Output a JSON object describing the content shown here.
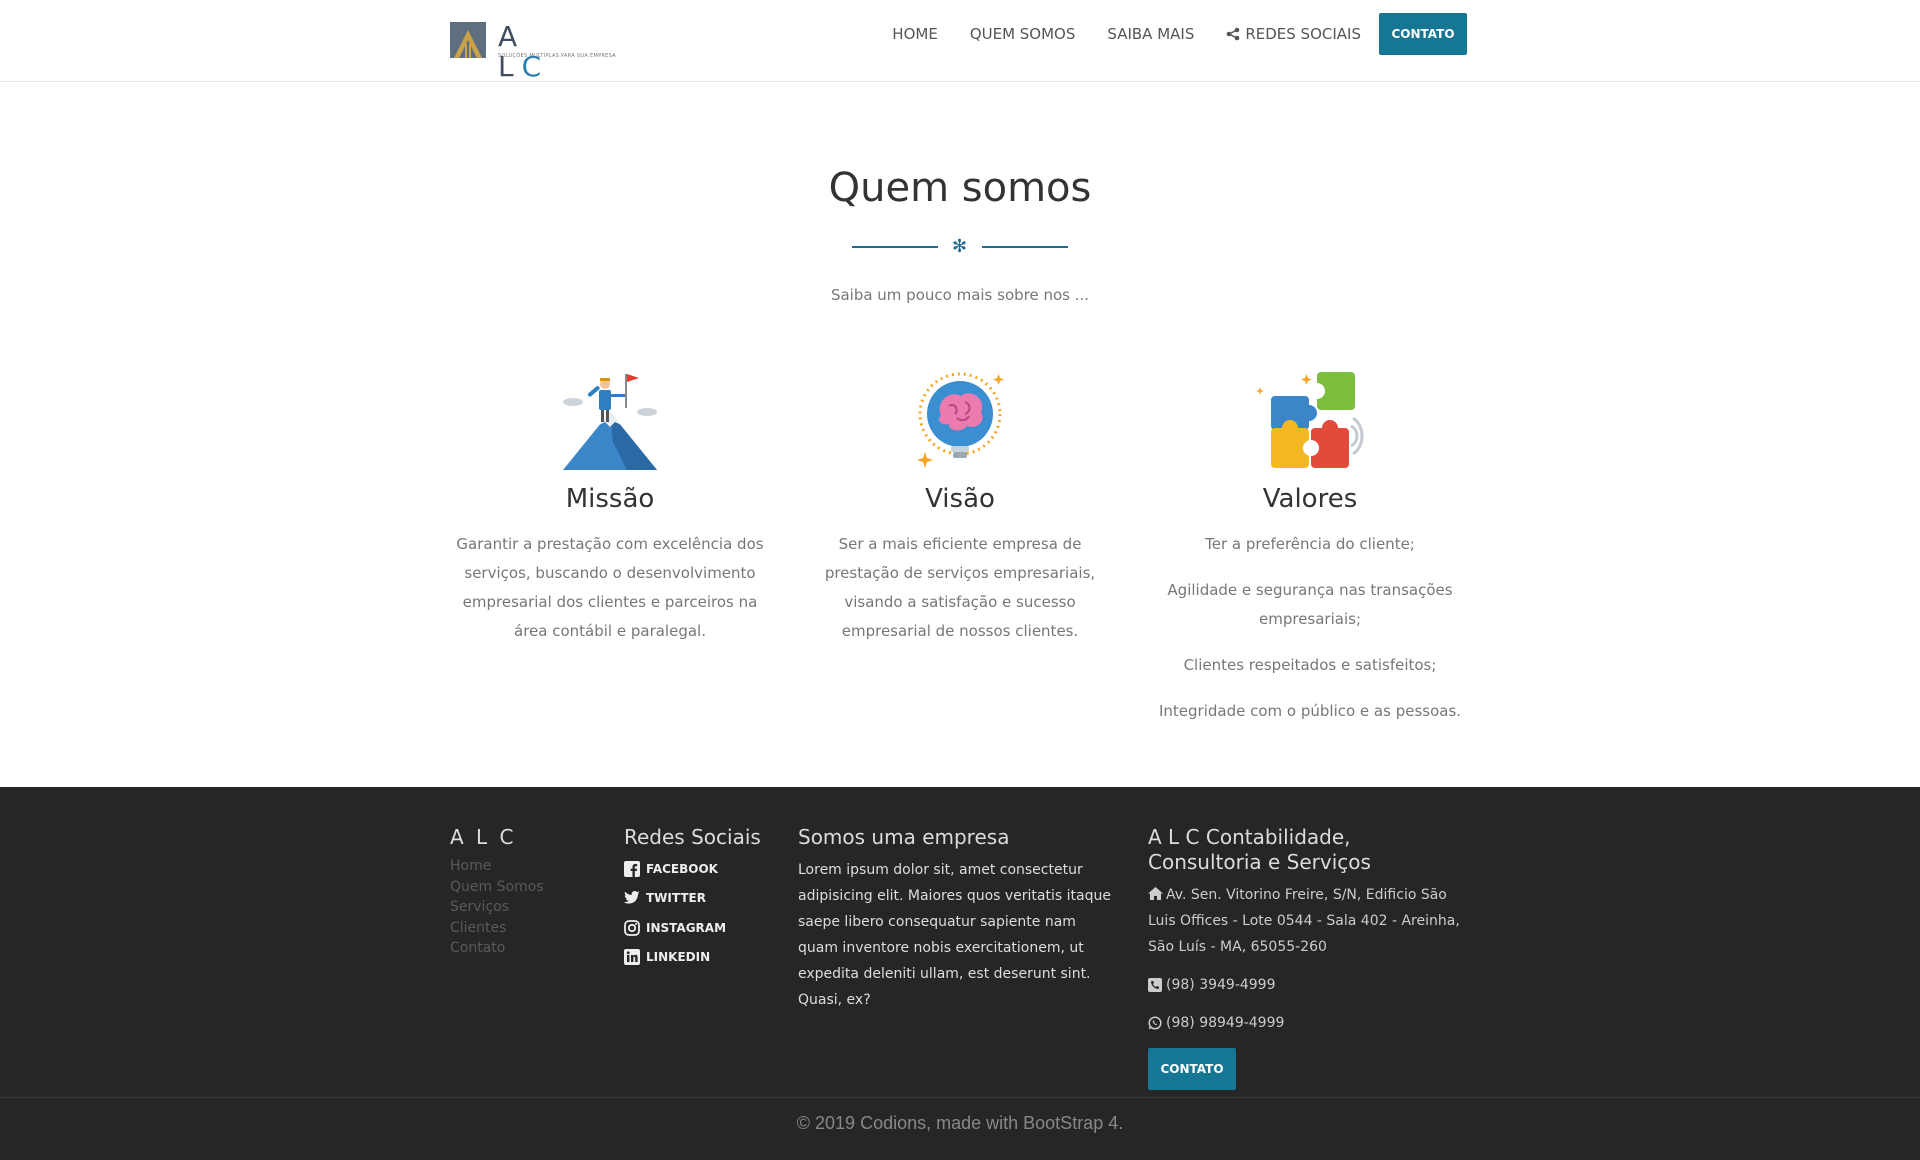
{
  "brand": {
    "letters": "A L",
    "accent_letter": "C",
    "tagline": "SOLUÇÕES MULTIPLAS PARA SUA EMPRESA"
  },
  "nav": {
    "items": [
      {
        "label": "HOME"
      },
      {
        "label": "QUEM SOMOS"
      },
      {
        "label": "SAIBA MAIS"
      },
      {
        "label": "REDES SOCIAIS",
        "icon": "share-icon"
      }
    ],
    "contact_button": "CONTATO"
  },
  "section": {
    "title": "Quem somos",
    "divider_symbol": "✻",
    "subtitle": "Saiba um pouco mais sobre nos ..."
  },
  "columns": [
    {
      "icon": "mountain-flag-icon",
      "title": "Missão",
      "paragraphs": [
        "Garantir a prestação com excelência dos serviços, buscando o desenvolvimento empresarial dos clientes e parceiros na área contábil e paralegal."
      ]
    },
    {
      "icon": "brain-lightbulb-icon",
      "title": "Visão",
      "paragraphs": [
        "Ser a mais eficiente empresa de prestação de serviços empresariais, visando a satisfação e sucesso empresarial de nossos clientes."
      ]
    },
    {
      "icon": "puzzle-icon",
      "title": "Valores",
      "paragraphs": [
        "Ter a preferência do cliente;",
        "Agilidade e segurança nas transações empresariais;",
        "Clientes respeitados e satisfeitos;",
        "Integridade com o público e as pessoas."
      ]
    }
  ],
  "footer": {
    "col1": {
      "title": "A L C",
      "links": [
        "Home",
        "Quem Somos",
        "Serviços",
        "Clientes",
        "Contato"
      ]
    },
    "col2": {
      "title": "Redes Sociais",
      "links": [
        {
          "label": "FACEBOOK",
          "icon": "facebook-icon"
        },
        {
          "label": "TWITTER",
          "icon": "twitter-icon"
        },
        {
          "label": "INSTAGRAM",
          "icon": "instagram-icon"
        },
        {
          "label": "LINKEDIN",
          "icon": "linkedin-icon"
        }
      ]
    },
    "col3": {
      "title": "Somos uma empresa",
      "text": "Lorem ipsum dolor sit, amet consectetur adipisicing elit. Maiores quos veritatis itaque saepe libero consequatur sapiente nam quam inventore nobis exercitationem, ut expedita deleniti ullam, est deserunt sint. Quasi, ex?"
    },
    "col4": {
      "title": "A L C Contabilidade, Consultoria e Serviços",
      "address": "Av. Sen. Vitorino Freire, S/N, Edificio São Luis Offices - Lote 0544 - Sala 402 - Areinha, São Luís - MA, 65055-260",
      "phone": "(98) 3949-4999",
      "whatsapp": "(98) 98949-4999",
      "contact_button": "CONTATO"
    },
    "copyright": "© 2019 Codions, made with BootStrap 4."
  },
  "colors": {
    "accent": "#167794",
    "footer_bg": "#262626",
    "divider": "#1f6b93"
  }
}
